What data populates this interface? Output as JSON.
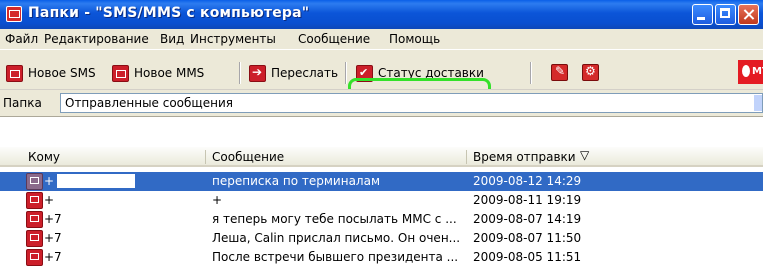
{
  "window": {
    "title": "Папки - \"SMS/MMS с компьютера\""
  },
  "menu": [
    "Файл",
    "Редактирование",
    "Вид",
    "Инструменты",
    "Сообщение",
    "Помощь"
  ],
  "toolbar": {
    "new_sms": "Новое SMS",
    "new_mms": "Новое MMS",
    "forward": "Переслать",
    "delivery_status": "Статус доставки",
    "logo_text": "МТ"
  },
  "folder": {
    "label": "Папка",
    "value": "Отправленные сообщения"
  },
  "columns": {
    "to": "Кому",
    "message": "Сообщение",
    "sent_time": "Время отправки"
  },
  "rows": [
    {
      "to": "+",
      "message": "переписка по терминалам",
      "time": "2009-08-12 14:29",
      "selected": true
    },
    {
      "to": "+",
      "message": "+",
      "time": "2009-08-11 19:19",
      "selected": false
    },
    {
      "to": "+7",
      "message": "я теперь могу тебе посылать ММС с ...",
      "time": "2009-08-07 14:19",
      "selected": false
    },
    {
      "to": "+7",
      "message": "Леша, Calin прислал письмо. Он очен...",
      "time": "2009-08-07 11:50",
      "selected": false
    },
    {
      "to": "+7",
      "message": "После встречи бывшего президента ...",
      "time": "2009-08-05 11:51",
      "selected": false
    }
  ],
  "colors": {
    "title_bar": "#0a55d8",
    "selection": "#316ac5",
    "highlight": "#34e12a",
    "accent_red": "#cc1f2a"
  }
}
